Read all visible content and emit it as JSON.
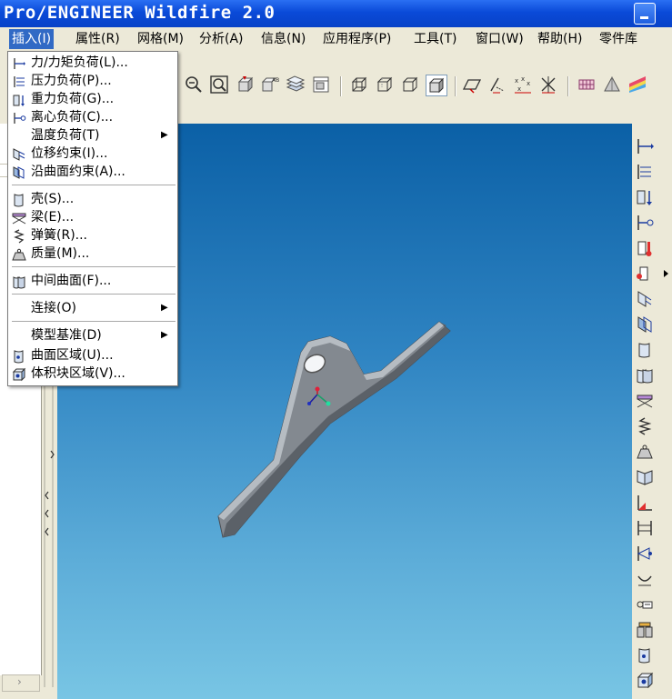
{
  "window": {
    "title": "Pro/ENGINEER Wildfire 2.0"
  },
  "menubar": {
    "items": [
      {
        "label": "插入(I)"
      },
      {
        "label": "属性(R)"
      },
      {
        "label": "网格(M)"
      },
      {
        "label": "分析(A)"
      },
      {
        "label": "信息(N)"
      },
      {
        "label": "应用程序(P)"
      },
      {
        "label": "工具(T)"
      },
      {
        "label": "窗口(W)"
      },
      {
        "label": "帮助(H)"
      },
      {
        "label": "零件库"
      }
    ]
  },
  "insert_menu": {
    "items": [
      {
        "label": "力/力矩负荷(L)...",
        "icon": "force-moment-icon"
      },
      {
        "label": "压力负荷(P)...",
        "icon": "pressure-load-icon"
      },
      {
        "label": "重力负荷(G)...",
        "icon": "gravity-load-icon"
      },
      {
        "label": "离心负荷(C)...",
        "icon": "centrifugal-load-icon"
      },
      {
        "label": "温度负荷(T)",
        "icon": "",
        "submenu": true
      },
      {
        "label": "位移约束(I)...",
        "icon": "displacement-constraint-icon"
      },
      {
        "label": "沿曲面约束(A)...",
        "icon": "surface-constraint-icon"
      },
      {
        "label": "壳(S)...",
        "icon": "shell-icon"
      },
      {
        "label": "梁(E)...",
        "icon": "beam-icon"
      },
      {
        "label": "弹簧(R)...",
        "icon": "spring-icon"
      },
      {
        "label": "质量(M)...",
        "icon": "mass-icon"
      },
      {
        "label": "中间曲面(F)...",
        "icon": "midsurface-icon"
      },
      {
        "label": "连接(O)",
        "icon": "",
        "submenu": true
      },
      {
        "label": "模型基准(D)",
        "icon": "",
        "submenu": true
      },
      {
        "label": "曲面区域(U)...",
        "icon": "surface-region-icon"
      },
      {
        "label": "体积块区域(V)...",
        "icon": "volume-region-icon"
      }
    ]
  },
  "colors": {
    "titlebar": "#0a4ad8",
    "menu_highlight": "#316ac5",
    "viewport_top": "#0b60a6",
    "viewport_bottom": "#78c5e4",
    "model_face": "#6b7178"
  }
}
